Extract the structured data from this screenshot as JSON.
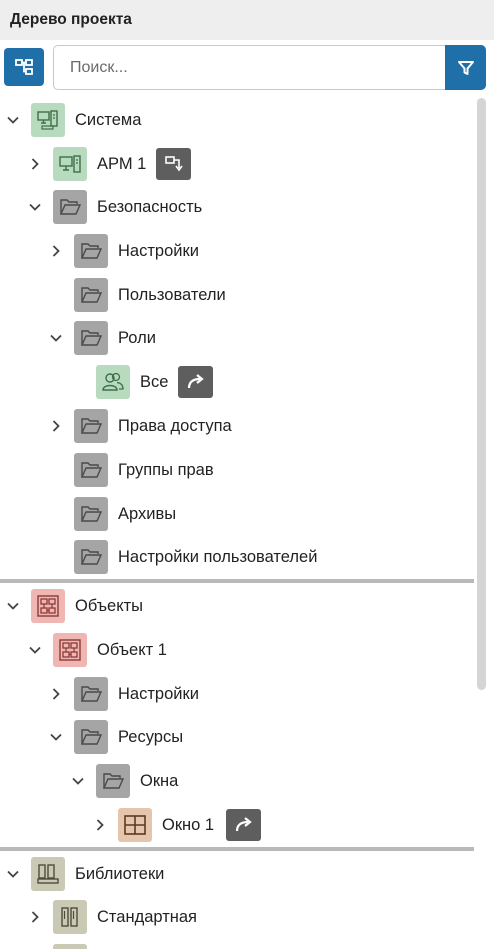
{
  "panel": {
    "title": "Дерево проекта"
  },
  "search": {
    "placeholder": "Поиск..."
  },
  "colors": {
    "accent": "#1f6fa8",
    "folder": "#a5a5a5",
    "system": "#b8dbbf",
    "objects": "#f0b6b3",
    "window": "#e5c6ad",
    "library": "#c9c9b6",
    "action": "#5e5e5e"
  },
  "tree": {
    "system": {
      "label": "Система",
      "arm": "АРМ 1",
      "security": {
        "label": "Безопасность",
        "settings": "Настройки",
        "users": "Пользователи",
        "roles": "Роли",
        "all": "Все",
        "access_rights": "Права доступа",
        "rights_groups": "Группы прав",
        "archives": "Архивы",
        "user_settings": "Настройки пользователей"
      }
    },
    "objects": {
      "label": "Объекты",
      "object1": "Объект 1",
      "settings": "Настройки",
      "resources": "Ресурсы",
      "windows": "Окна",
      "window1": "Окно 1"
    },
    "libraries": {
      "label": "Библиотеки",
      "standard": "Стандартная"
    }
  }
}
